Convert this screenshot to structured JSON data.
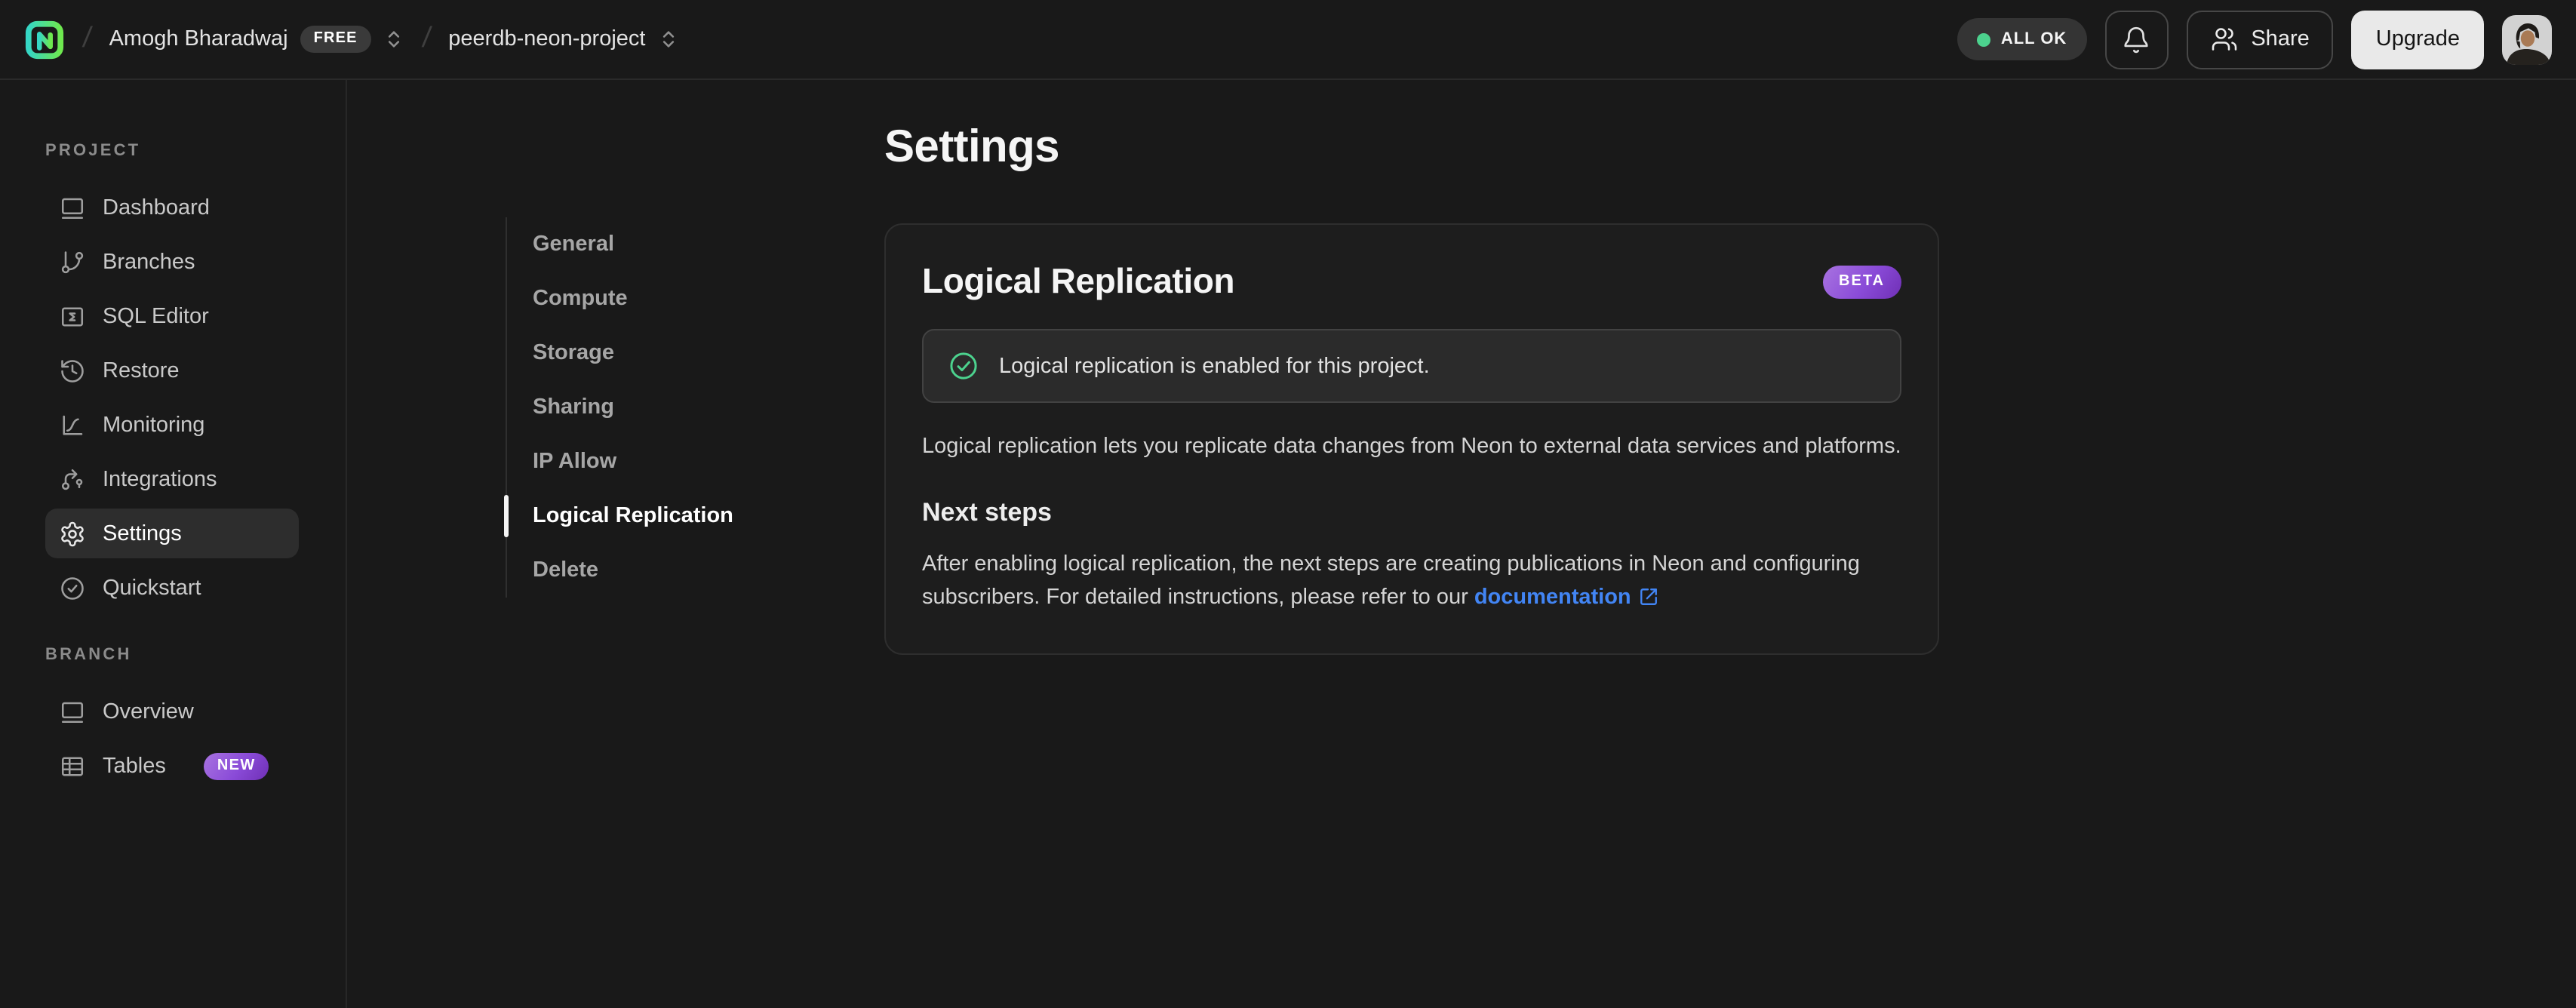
{
  "topbar": {
    "org_name": "Amogh Bharadwaj",
    "org_plan_badge": "FREE",
    "project_name": "peerdb-neon-project",
    "status_label": "ALL OK",
    "share_label": "Share",
    "upgrade_label": "Upgrade"
  },
  "sidebar": {
    "sections": [
      {
        "label": "PROJECT",
        "items": [
          {
            "label": "Dashboard",
            "icon": "dashboard-icon",
            "active": false
          },
          {
            "label": "Branches",
            "icon": "git-branch-icon",
            "active": false
          },
          {
            "label": "SQL Editor",
            "icon": "sql-editor-icon",
            "active": false
          },
          {
            "label": "Restore",
            "icon": "history-icon",
            "active": false
          },
          {
            "label": "Monitoring",
            "icon": "chart-line-icon",
            "active": false
          },
          {
            "label": "Integrations",
            "icon": "integrations-icon",
            "active": false
          },
          {
            "label": "Settings",
            "icon": "gear-icon",
            "active": true
          },
          {
            "label": "Quickstart",
            "icon": "check-circle-icon",
            "active": false
          }
        ]
      },
      {
        "label": "BRANCH",
        "items": [
          {
            "label": "Overview",
            "icon": "window-icon",
            "active": false
          },
          {
            "label": "Tables",
            "icon": "table-icon",
            "active": false,
            "badge": "NEW"
          }
        ]
      }
    ]
  },
  "settings_nav": {
    "items": [
      {
        "label": "General",
        "active": false
      },
      {
        "label": "Compute",
        "active": false
      },
      {
        "label": "Storage",
        "active": false
      },
      {
        "label": "Sharing",
        "active": false
      },
      {
        "label": "IP Allow",
        "active": false
      },
      {
        "label": "Logical Replication",
        "active": true
      },
      {
        "label": "Delete",
        "active": false
      }
    ]
  },
  "main": {
    "page_title": "Settings",
    "card": {
      "title": "Logical Replication",
      "beta_badge": "BETA",
      "success_banner": "Logical replication is enabled for this project.",
      "description": "Logical replication lets you replicate data changes from Neon to external data services and platforms.",
      "next_steps_title": "Next steps",
      "next_steps_text": "After enabling logical replication, the next steps are creating publications in Neon and configuring subscribers. For detailed instructions, please refer to our ",
      "next_steps_link_label": "documentation"
    }
  },
  "colors": {
    "background": "#191919",
    "accent_green": "#4cd28e",
    "badge_purple_start": "#a873e0",
    "badge_purple_end": "#6f2fb5",
    "link_blue": "#4285f4"
  }
}
